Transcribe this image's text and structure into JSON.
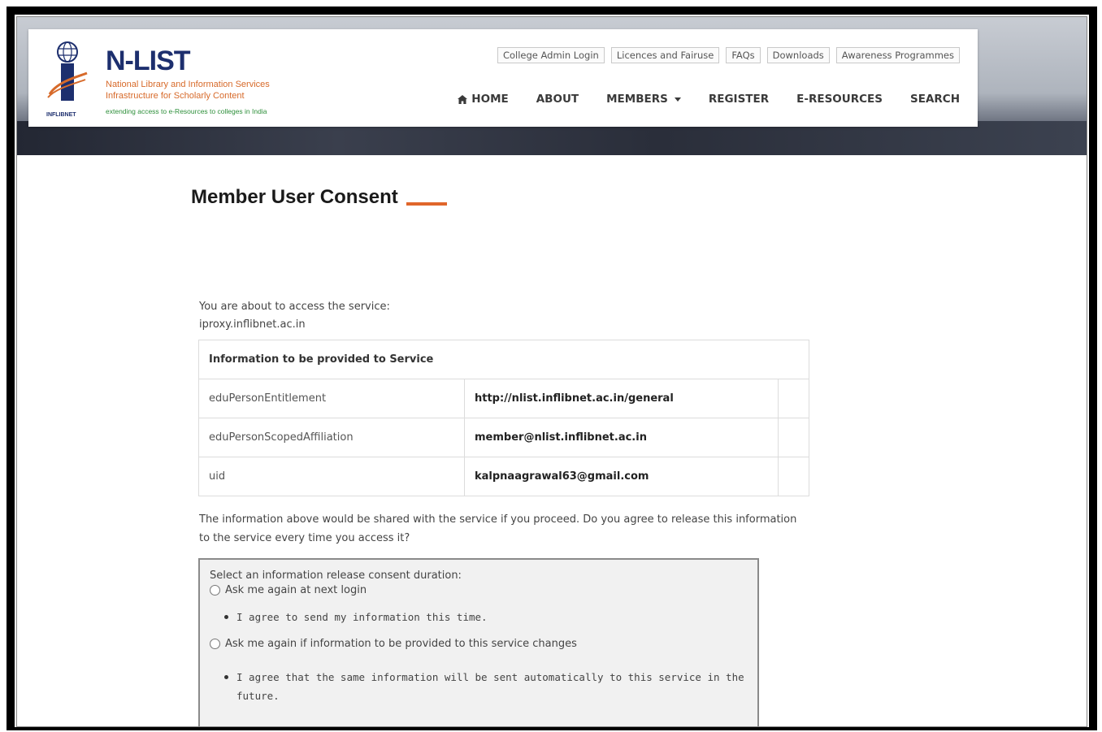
{
  "brand": {
    "title": "N-LIST",
    "line1": "National Library and Information Services",
    "line2": "Infrastructure for Scholarly Content",
    "line3": "extending access to e-Resources to colleges in India",
    "logo_label": "INFLIBNET",
    "title_color": "#1d2f6e",
    "accent_color": "#d76a2a",
    "tagline_color": "#2d8f3a"
  },
  "top_links": [
    "College Admin Login",
    "Licences and Fairuse",
    "FAQs",
    "Downloads",
    "Awareness Programmes"
  ],
  "nav": {
    "home": "HOME",
    "about": "ABOUT",
    "members": "MEMBERS",
    "register": "REGISTER",
    "eresources": "E-RESOURCES",
    "search": "SEARCH"
  },
  "page": {
    "title": "Member User Consent",
    "accent_color": "#e0662b",
    "intro_line1": "You are about to access the service:",
    "intro_line2": "iproxy.inflibnet.ac.in"
  },
  "info_table": {
    "header": "Information to be provided to Service",
    "rows": [
      {
        "attribute": "eduPersonEntitlement",
        "value": "http://nlist.inflibnet.ac.in/general"
      },
      {
        "attribute": "eduPersonScopedAffiliation",
        "value": "member@nlist.inflibnet.ac.in"
      },
      {
        "attribute": "uid",
        "value": "kalpnaagrawal63@gmail.com"
      }
    ]
  },
  "question": "The information above would be shared with the service if you proceed. Do you agree to release this information to the service every time you access it?",
  "consent": {
    "label": "Select an information release consent duration:",
    "option1": "Ask me again at next login",
    "option1_note": "I agree to send my information this time.",
    "option2": "Ask me again if information to be provided to this service changes",
    "option2_note": "I agree that the same information will be sent automatically to this service in the future."
  }
}
